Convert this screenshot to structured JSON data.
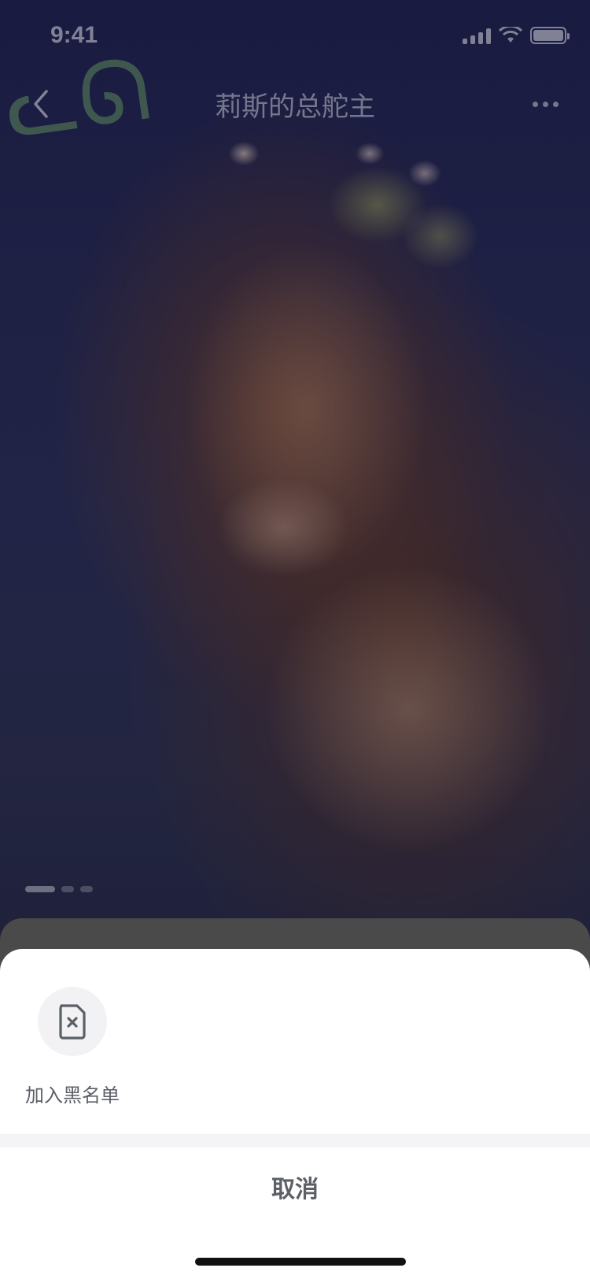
{
  "status_bar": {
    "time": "9:41",
    "icons": [
      "cellular-signal-icon",
      "wifi-icon",
      "battery-icon"
    ]
  },
  "nav": {
    "back_icon": "chevron-left-icon",
    "title": "莉斯的总舵主",
    "more_icon": "more-horizontal-icon"
  },
  "gallery": {
    "page_count": 3,
    "current_page": 1
  },
  "action_sheet": {
    "actions": [
      {
        "label": "加入黑名单",
        "icon": "blacklist-document-icon"
      }
    ],
    "cancel_label": "取消"
  },
  "colors": {
    "sheet_bg": "#ffffff",
    "text_secondary": "#5b5f66",
    "icon_circle_bg": "#f2f2f4",
    "dim_overlay": "rgba(0,0,0,0.42)"
  }
}
